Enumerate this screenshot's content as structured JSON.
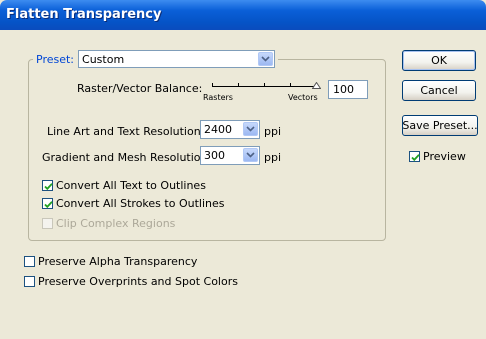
{
  "window": {
    "title": "Flatten Transparency"
  },
  "preset": {
    "label": "Preset:",
    "value": "Custom"
  },
  "balance": {
    "label": "Raster/Vector Balance:",
    "value": "100",
    "value_fraction": 1.0,
    "min_label": "Rasters",
    "max_label": "Vectors"
  },
  "line_art": {
    "label": "Line Art and Text Resolution:",
    "value": "2400",
    "unit": "ppi"
  },
  "gradient": {
    "label": "Gradient and Mesh Resolution:",
    "value": "300",
    "unit": "ppi"
  },
  "options": [
    {
      "label": "Convert All Text to Outlines",
      "checked": true,
      "disabled": false
    },
    {
      "label": "Convert All Strokes to Outlines",
      "checked": true,
      "disabled": false
    },
    {
      "label": "Clip Complex Regions",
      "checked": false,
      "disabled": true
    }
  ],
  "preserve": [
    {
      "label": "Preserve Alpha Transparency",
      "checked": false
    },
    {
      "label": "Preserve Overprints and Spot Colors",
      "checked": false
    }
  ],
  "buttons": {
    "ok": "OK",
    "cancel": "Cancel",
    "save_preset": "Save Preset..."
  },
  "preview": {
    "label": "Preview",
    "checked": true
  },
  "colors": {
    "title_bar": "#0553c6",
    "dialog_bg": "#ece9d8",
    "group_label": "#0046d5",
    "checkmark": "#21a121"
  }
}
